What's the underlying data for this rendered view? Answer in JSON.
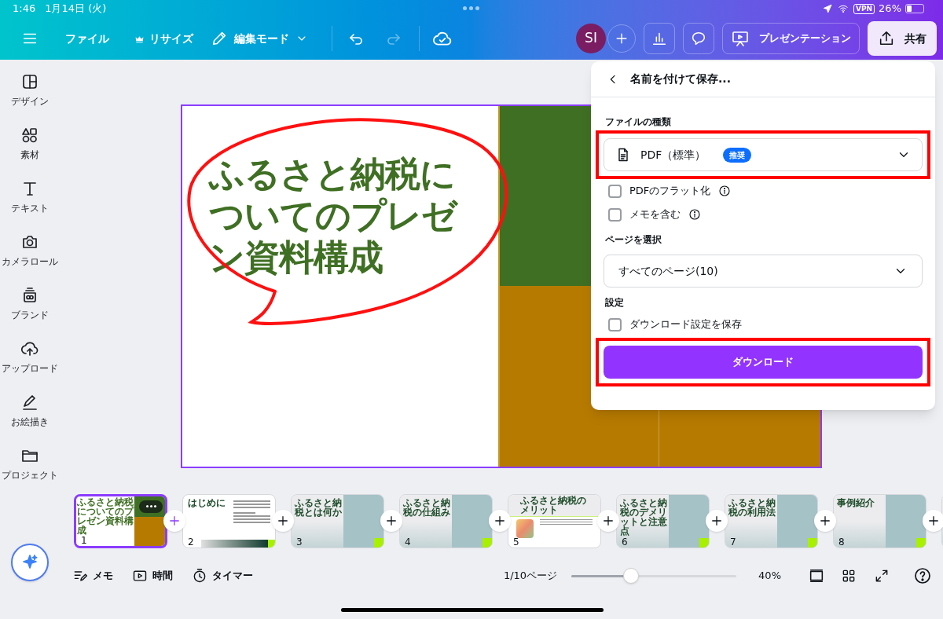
{
  "status_bar": {
    "time": "1:46",
    "date": "1月14日 (火)",
    "vpn": "VPN",
    "battery": "26%"
  },
  "toolbar": {
    "file_menu": "ファイル",
    "resize": "リサイズ",
    "mode": "編集モード",
    "avatar": "SI",
    "present": "プレゼンテーション",
    "share": "共有"
  },
  "sidebar": {
    "items": [
      {
        "label": "デザイン"
      },
      {
        "label": "素材"
      },
      {
        "label": "テキスト"
      },
      {
        "label": "カメラロール"
      },
      {
        "label": "ブランド"
      },
      {
        "label": "アップロード"
      },
      {
        "label": "お絵描き"
      },
      {
        "label": "プロジェクト"
      }
    ]
  },
  "canvas": {
    "title": "ふるさと納税についてのプレゼン資料構成"
  },
  "save_panel": {
    "title": "名前を付けて保存...",
    "file_type_label": "ファイルの種類",
    "file_type": "PDF（標準）",
    "badge": "推奨",
    "options": [
      {
        "label": "PDFのフラット化",
        "checked": false
      },
      {
        "label": "メモを含む",
        "checked": false
      }
    ],
    "page_label": "ページを選択",
    "pages": "すべてのページ(10)",
    "settings_label": "設定",
    "save_settings": {
      "label": "ダウンロード設定を保存",
      "checked": false
    },
    "download": "ダウンロード"
  },
  "filmstrip": {
    "slides": [
      {
        "number": "1",
        "title": "ふるさと納税についてのプレゼン資料構成",
        "kind": "cover",
        "selected": true
      },
      {
        "number": "2",
        "title": "はじめに",
        "kind": "text",
        "selected": false
      },
      {
        "number": "3",
        "title": "ふるさと納税とは何か",
        "kind": "split",
        "selected": false
      },
      {
        "number": "4",
        "title": "ふるさと納税の仕組み",
        "kind": "split",
        "selected": false
      },
      {
        "number": "5",
        "title": "ふるさと納税のメリット",
        "kind": "photo",
        "selected": false
      },
      {
        "number": "6",
        "title": "ふるさと納税のデメリットと注意点",
        "kind": "split",
        "selected": false
      },
      {
        "number": "7",
        "title": "ふるさと納税の利用法",
        "kind": "split",
        "selected": false
      },
      {
        "number": "8",
        "title": "事例紹介",
        "kind": "split",
        "selected": false
      },
      {
        "kind": "split",
        "selected": false
      }
    ]
  },
  "bottom_bar": {
    "notes": "メモ",
    "duration": "時間",
    "timer": "タイマー",
    "page": "1/10ページ",
    "zoom_slider": {
      "level": 0.36
    },
    "zoom": "40%"
  }
}
